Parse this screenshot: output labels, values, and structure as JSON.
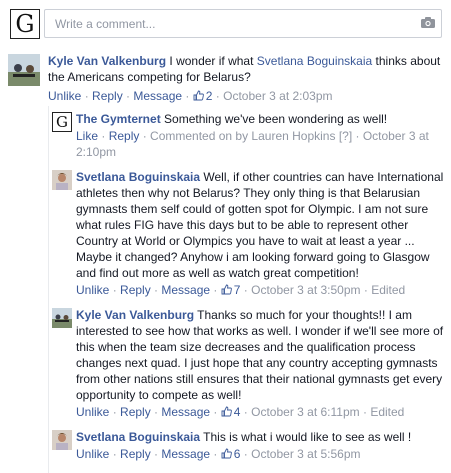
{
  "composer": {
    "avatar_letter": "G",
    "placeholder": "Write a comment...",
    "camera_icon": "camera-icon"
  },
  "comments": [
    {
      "author": "Kyle Van Valkenburg",
      "text_before": " I wonder if what ",
      "mention": "Svetlana Boguinskaia",
      "text_after": " thinks about the Americans competing for Belarus?",
      "actions": {
        "unlike": "Unlike",
        "reply": "Reply",
        "message": "Message",
        "likes": "2",
        "time": "October 3 at 2:03pm"
      }
    },
    {
      "author": "The Gymternet",
      "avatar_letter": "G",
      "text": " Something we've been wondering as well!",
      "actions": {
        "like": "Like",
        "reply": "Reply",
        "commented_on_by": "Commented on by Lauren Hopkins",
        "help": "[?]",
        "time": "October 3 at 2:10pm"
      }
    },
    {
      "author": "Svetlana Boguinskaia",
      "text": " Well, if other countries can have International athletes then why not Belarus? They only thing is that Belarusian gymnasts them self could of gotten spot for Olympic. I am not sure what rules FIG have this days but to be able to represent other Country at World or Olympics you have to wait at least a year ... Maybe it changed? Anyhow i am looking forward going to Glasgow and find out more as well as watch great competition!",
      "actions": {
        "unlike": "Unlike",
        "reply": "Reply",
        "message": "Message",
        "likes": "7",
        "time": "October 3 at 3:50pm",
        "edited": "Edited"
      }
    },
    {
      "author": "Kyle Van Valkenburg",
      "text": " Thanks so much for your thoughts!! I am interested to see how that works as well. I wonder if we'll see more of this when the team size decreases and the qualification process changes next quad. I just hope that any country accepting gymnasts from other nations still ensures that their national gymnasts get every opportunity to compete as well!",
      "actions": {
        "unlike": "Unlike",
        "reply": "Reply",
        "message": "Message",
        "likes": "4",
        "time": "October 3 at 6:11pm",
        "edited": "Edited"
      }
    },
    {
      "author": "Svetlana Boguinskaia",
      "text": " This is what i would like to see as well !",
      "actions": {
        "unlike": "Unlike",
        "reply": "Reply",
        "message": "Message",
        "likes": "6",
        "time": "October 3 at 5:56pm"
      }
    }
  ],
  "sep": " · "
}
